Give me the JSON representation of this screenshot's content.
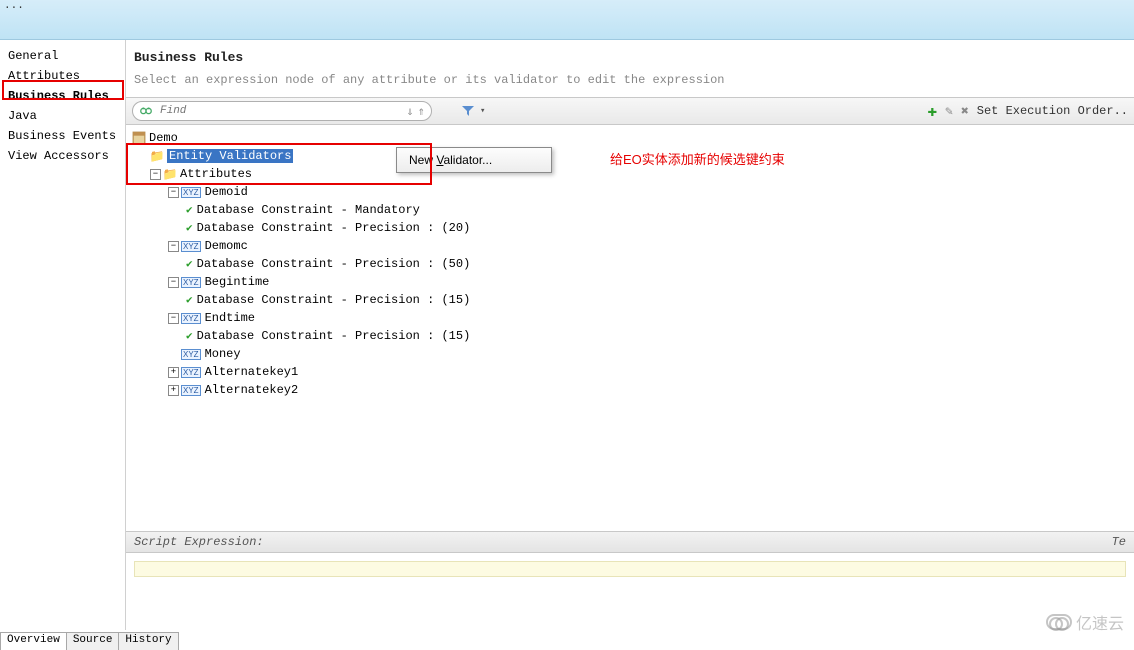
{
  "sidebar": {
    "items": [
      {
        "label": "General"
      },
      {
        "label": "Attributes"
      },
      {
        "label": "Business Rules"
      },
      {
        "label": "Java"
      },
      {
        "label": "Business Events"
      },
      {
        "label": "View Accessors"
      }
    ],
    "active_index": 2
  },
  "header": {
    "title": "Business Rules",
    "subtitle": "Select an expression node of any attribute or its validator to edit the expression"
  },
  "toolbar": {
    "search_placeholder": "Find",
    "exec_order_label": "Set Execution Order.."
  },
  "tree": {
    "root": "Demo",
    "entity_validators": "Entity Validators",
    "attributes_label": "Attributes",
    "nodes": [
      {
        "name": "Demoid",
        "constraints": [
          {
            "text": "Database Constraint - Mandatory"
          },
          {
            "text": "Database Constraint - Precision :  (20)"
          }
        ]
      },
      {
        "name": "Demomc",
        "constraints": [
          {
            "text": "Database Constraint - Precision :  (50)"
          }
        ]
      },
      {
        "name": "Begintime",
        "constraints": [
          {
            "text": "Database Constraint - Precision :  (15)"
          }
        ]
      },
      {
        "name": "Endtime",
        "constraints": [
          {
            "text": "Database Constraint - Precision :  (15)"
          }
        ]
      },
      {
        "name": "Money",
        "constraints": []
      },
      {
        "name": "Alternatekey1",
        "constraints": [],
        "collapsed": true
      },
      {
        "name": "Alternatekey2",
        "constraints": [],
        "collapsed": true
      }
    ]
  },
  "context_menu": {
    "item": "New Validator..."
  },
  "annotation": "给EO实体添加新的候选键约束",
  "script_panel": {
    "title": "Script Expression:",
    "right_label": "Te"
  },
  "bottom_tabs": [
    "Overview",
    "Source",
    "History"
  ],
  "watermark": "亿速云"
}
